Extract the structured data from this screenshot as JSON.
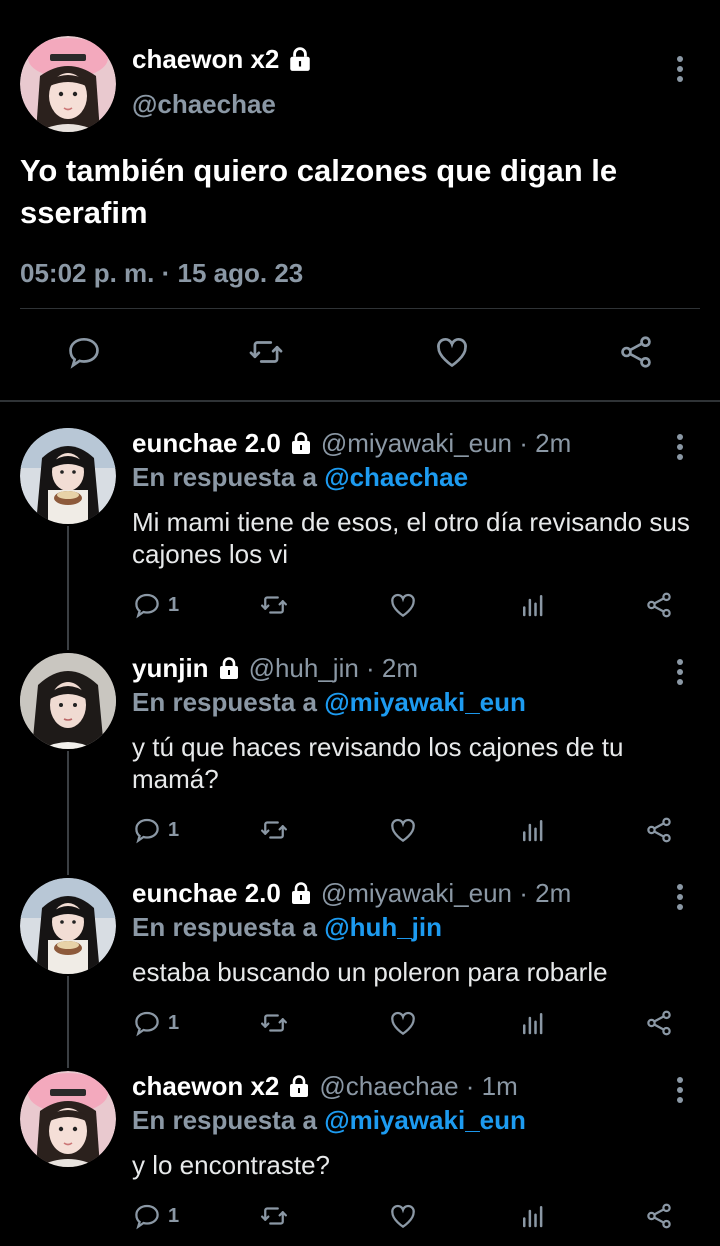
{
  "main_tweet": {
    "display_name": "chaewon x2",
    "handle": "@chaechae",
    "text": "Yo también quiero calzones que digan le sserafim",
    "timestamp": "05:02 p. m. · 15 ago. 23"
  },
  "replies": [
    {
      "display_name": "eunchae 2.0",
      "meta": "@miyawaki_eun · 2m",
      "reply_prefix": "En respuesta a",
      "reply_to": "@chaechae",
      "text": "Mi mami tiene de esos, el otro día revisando sus cajones los vi",
      "reply_count": "1"
    },
    {
      "display_name": "yunjin",
      "meta": "@huh_jin · 2m",
      "reply_prefix": "En respuesta a",
      "reply_to": "@miyawaki_eun",
      "text": "y tú que haces revisando los cajones de tu mamá?",
      "reply_count": "1"
    },
    {
      "display_name": "eunchae 2.0",
      "meta": "@miyawaki_eun · 2m",
      "reply_prefix": "En respuesta a",
      "reply_to": "@huh_jin",
      "text": "estaba buscando un poleron para robarle",
      "reply_count": "1"
    },
    {
      "display_name": "chaewon x2",
      "meta": "@chaechae · 1m",
      "reply_prefix": "En respuesta a",
      "reply_to": "@miyawaki_eun",
      "text": "y lo encontraste?",
      "reply_count": "1"
    }
  ],
  "icons": {
    "lock": "lock-icon",
    "more": "more-vertical-icon",
    "reply": "reply-icon",
    "retweet": "retweet-icon",
    "like": "heart-icon",
    "views": "views-icon",
    "share": "share-icon"
  },
  "colors": {
    "background": "#000000",
    "text": "#e7e9ea",
    "secondary": "#8b98a5",
    "mention": "#1d9bf0",
    "divider": "#2f3336"
  }
}
